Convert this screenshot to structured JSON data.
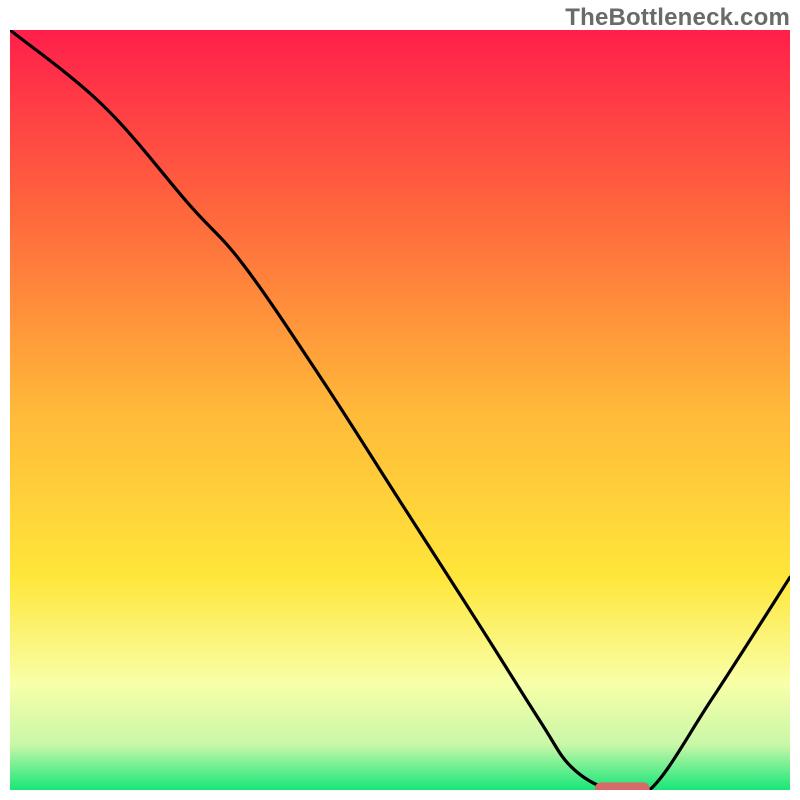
{
  "watermark": "TheBottleneck.com",
  "chart_data": {
    "type": "line",
    "title": "",
    "xlabel": "",
    "ylabel": "",
    "xlim": [
      0,
      100
    ],
    "ylim": [
      0,
      100
    ],
    "grid": false,
    "legend": false,
    "background_gradient_stops": [
      {
        "offset": 0.0,
        "color": "#ff1f4b"
      },
      {
        "offset": 0.25,
        "color": "#ff6a3c"
      },
      {
        "offset": 0.5,
        "color": "#ffb93a"
      },
      {
        "offset": 0.72,
        "color": "#ffe63a"
      },
      {
        "offset": 0.86,
        "color": "#f8ffa8"
      },
      {
        "offset": 0.94,
        "color": "#c9f7a8"
      },
      {
        "offset": 1.0,
        "color": "#17e67a"
      }
    ],
    "series": [
      {
        "name": "bottleneck-curve",
        "color": "#000000",
        "x": [
          0,
          12,
          23,
          30,
          40,
          50,
          60,
          68,
          72,
          77,
          82,
          90,
          100
        ],
        "y": [
          100,
          90,
          77,
          69,
          54,
          38,
          22,
          9,
          3,
          0,
          0,
          12,
          28
        ]
      }
    ],
    "marker": {
      "name": "optimal-zone",
      "color": "#d96a6a",
      "x_start": 75,
      "x_end": 82,
      "y": 0,
      "thickness": 2
    }
  }
}
